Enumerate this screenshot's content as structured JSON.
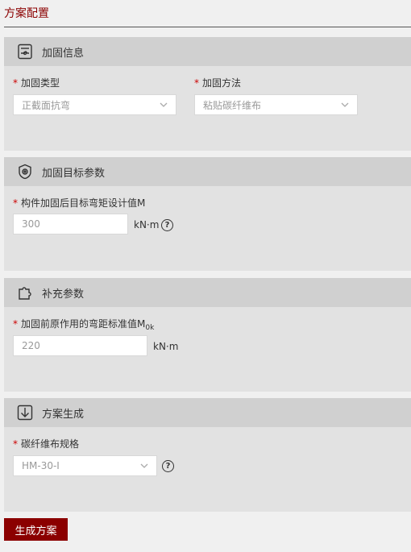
{
  "page": {
    "title": "方案配置"
  },
  "sections": {
    "reinforce_info": {
      "title": "加固信息",
      "type_label": "加固类型",
      "type_value": "正截面抗弯",
      "method_label": "加固方法",
      "method_value": "粘贴碳纤维布"
    },
    "target_params": {
      "title": "加固目标参数",
      "moment_label": "构件加固后目标弯矩设计值M",
      "moment_value": "300",
      "unit": "kN·m"
    },
    "supplement": {
      "title": "补充参数",
      "moment_label_prefix": "加固前原作用的弯距标准值M",
      "moment_label_sub": "0k",
      "moment_value": "220",
      "unit": "kN·m"
    },
    "plan_generate": {
      "title": "方案生成",
      "spec_label": "碳纤维布规格",
      "spec_value": "HM-30-I"
    }
  },
  "common": {
    "required_mark": "*",
    "help_mark": "?"
  },
  "actions": {
    "generate_label": "生成方案"
  },
  "colors": {
    "accent": "#8b0000",
    "panel": "#e2e2e2",
    "panel_head": "#d0d0d0"
  }
}
